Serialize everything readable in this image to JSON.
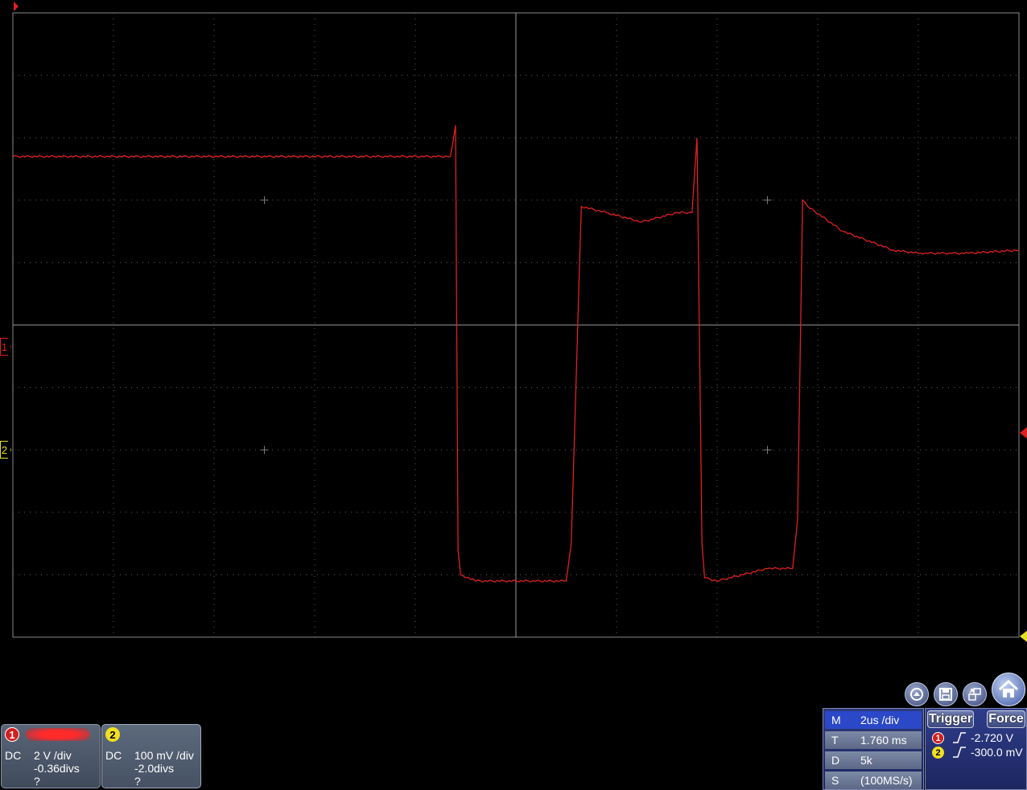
{
  "colors": {
    "ch1": "#e02020",
    "ch2": "#e6e020",
    "grid": "#6a6a6a",
    "background": "#000000"
  },
  "markers": {
    "ch1": "1",
    "ch2": "2"
  },
  "ch1": {
    "number": "1",
    "coupling": "DC",
    "scale": "2 V /div",
    "offset": "-0.36divs",
    "probe": "?"
  },
  "ch2": {
    "number": "2",
    "coupling": "DC",
    "scale": "100 mV /div",
    "offset": "-2.0divs",
    "probe": "?"
  },
  "timebase": {
    "rows": [
      {
        "key": "M",
        "value": "2us /div"
      },
      {
        "key": "T",
        "value": "1.760 ms"
      },
      {
        "key": "D",
        "value": "5k"
      },
      {
        "key": "S",
        "value": "(100MS/s)"
      }
    ]
  },
  "trigger": {
    "trigger_label": "Trigger",
    "force_label": "Force",
    "ch1_level": "-2.720 V",
    "ch2_level": "-300.0 mV"
  },
  "icons": [
    "autoset-icon",
    "save-icon",
    "switch-icon",
    "home-icon"
  ],
  "chart_data": {
    "type": "line",
    "title": "",
    "xlabel": "",
    "ylabel": "",
    "grid": true,
    "x_divisions": 10,
    "y_divisions": 10,
    "xlim": [
      -10,
      10
    ],
    "ylim": [
      -4,
      6
    ],
    "series": [
      {
        "color": "#e02020",
        "x": [
          -10,
          -1.3,
          -1.2,
          -1.15,
          -1.1,
          -0.8,
          1.0,
          1.1,
          1.3,
          1.8,
          2.5,
          3.2,
          3.5,
          3.6,
          3.7,
          3.75,
          4.0,
          5.0,
          5.5,
          5.6,
          5.7,
          5.8,
          6.5,
          7.5,
          8.0,
          9.0,
          10.0
        ],
        "y": [
          3.7,
          3.7,
          4.2,
          -2.6,
          -3.0,
          -3.1,
          -3.1,
          -2.5,
          2.9,
          2.8,
          2.65,
          2.8,
          2.8,
          4.0,
          -2.5,
          -3.05,
          -3.1,
          -2.9,
          -2.9,
          -2.1,
          3.0,
          2.9,
          2.5,
          2.2,
          2.15,
          2.15,
          2.2
        ]
      }
    ]
  }
}
